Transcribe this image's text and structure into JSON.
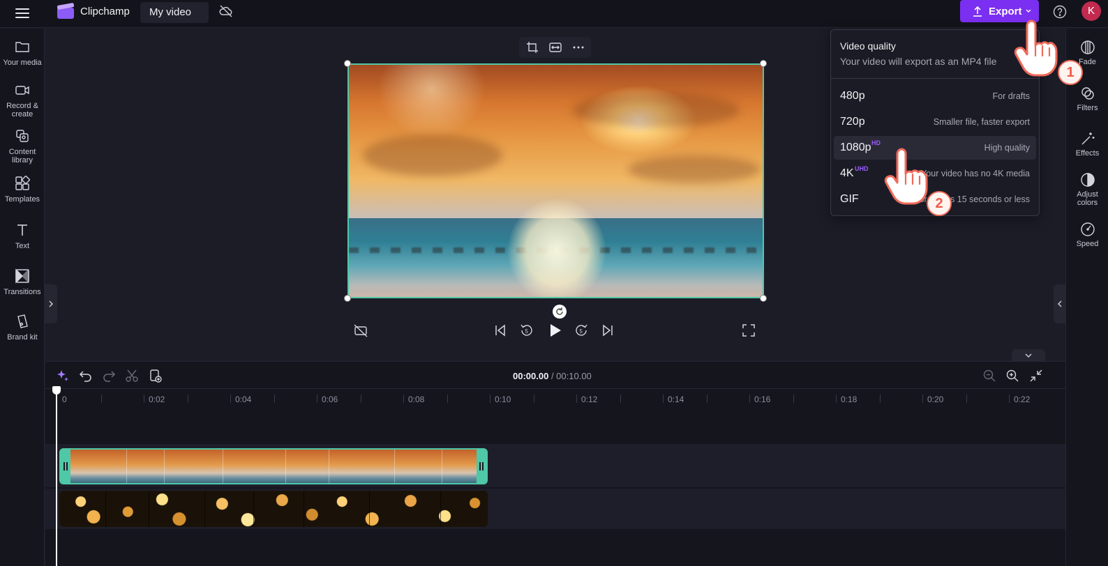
{
  "topbar": {
    "brand": "Clipchamp",
    "project_title": "My video",
    "export_label": "Export",
    "avatar_initial": "K"
  },
  "left_sidebar": {
    "items": [
      {
        "label": "Your media",
        "icon": "folder-icon"
      },
      {
        "label": "Record & create",
        "icon": "camera-icon"
      },
      {
        "label": "Content library",
        "icon": "library-icon"
      },
      {
        "label": "Templates",
        "icon": "templates-icon"
      },
      {
        "label": "Text",
        "icon": "text-icon"
      },
      {
        "label": "Transitions",
        "icon": "transitions-icon"
      },
      {
        "label": "Brand kit",
        "icon": "brand-kit-icon"
      }
    ]
  },
  "right_sidebar": {
    "items": [
      {
        "label": "Fade",
        "icon": "fade-icon"
      },
      {
        "label": "Filters",
        "icon": "filters-icon"
      },
      {
        "label": "Effects",
        "icon": "effects-icon"
      },
      {
        "label": "Adjust colors",
        "icon": "adjust-colors-icon"
      },
      {
        "label": "Speed",
        "icon": "speed-icon"
      }
    ]
  },
  "export_menu": {
    "title": "Video quality",
    "subtitle": "Your video will export as an MP4 file",
    "options": [
      {
        "name": "480p",
        "badge": "",
        "desc": "For drafts"
      },
      {
        "name": "720p",
        "badge": "",
        "desc": "Smaller file, faster export"
      },
      {
        "name": "1080p",
        "badge": "HD",
        "desc": "High quality",
        "highlighted": true
      },
      {
        "name": "4K",
        "badge": "UHD",
        "desc": "Your video has no 4K media"
      },
      {
        "name": "GIF",
        "badge": "",
        "desc": "For videos 15 seconds or less"
      }
    ]
  },
  "timeline": {
    "current_time": "00:00.00",
    "separator": " / ",
    "total_time": "00:10.00",
    "ruler": [
      "0",
      "0:02",
      "0:04",
      "0:06",
      "0:08",
      "0:10",
      "0:12",
      "0:14",
      "0:16",
      "0:18",
      "0:20",
      "0:22"
    ]
  },
  "annotations": {
    "step1": "1",
    "step2": "2"
  },
  "colors": {
    "accent": "#7b2ff0",
    "selection": "#4fc8a7",
    "step_badge": "#ef6b5a"
  }
}
